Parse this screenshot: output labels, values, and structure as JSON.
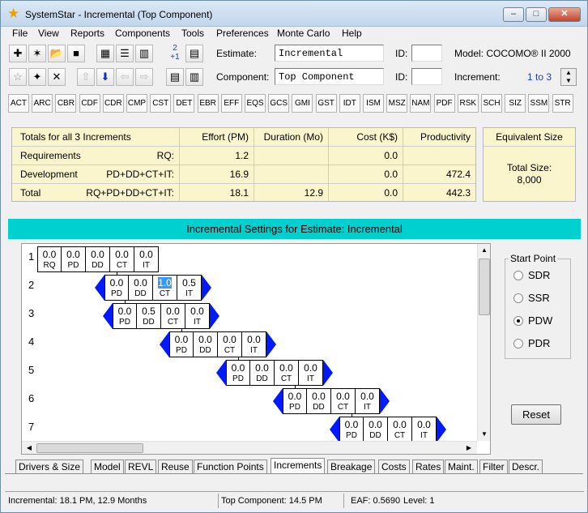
{
  "window": {
    "title": "SystemStar - Incremental (Top Component)",
    "icon": "star-icon"
  },
  "menu": [
    "File",
    "View",
    "Reports",
    "Components",
    "Tools",
    "Preferences",
    "Monte Carlo",
    "Help"
  ],
  "toolbar": {
    "row1_icons": [
      "new-estimate-icon",
      "new-star-icon",
      "open-folder-icon",
      "save-disk-icon",
      "grid-view-icon",
      "list-view-icon",
      "chart-view-icon",
      "increment-counter-icon",
      "report-icon"
    ],
    "row2_icons": [
      "star-outline-icon",
      "star-tree-icon",
      "delete-x-icon",
      "arrow-up-icon",
      "arrow-down-icon",
      "arrow-left-icon",
      "arrow-right-icon",
      "document-icon",
      "document-detail-icon"
    ],
    "increment_label_top": "2",
    "increment_label_bottom": "+1"
  },
  "estimate": {
    "label": "Estimate:",
    "value": "Incremental",
    "id_label": "ID:",
    "id_value": "",
    "model": "Model: COCOMO® II 2000"
  },
  "component": {
    "label": "Component:",
    "value": "Top Component",
    "id_label": "ID:",
    "id_value": "",
    "increment_label": "Increment:",
    "increment_range": "1 to 3"
  },
  "driver_tags": [
    "ACT",
    "ARC",
    "CBR",
    "CDF",
    "CDR",
    "CMP",
    "CST",
    "DET",
    "EBR",
    "EFF",
    "EQS",
    "GCS",
    "GMI",
    "GST",
    "IDT",
    "ISM",
    "MSZ",
    "NAM",
    "PDF",
    "RSK",
    "SCH",
    "SIZ",
    "SSM",
    "STR"
  ],
  "summary": {
    "headers": [
      "Totals for all 3 Increments",
      "Effort (PM)",
      "Duration (Mo)",
      "Cost (K$)",
      "Productivity"
    ],
    "rows": [
      {
        "name": "Requirements",
        "code": "RQ:",
        "effort": "1.2",
        "duration": "",
        "cost": "0.0",
        "productivity": ""
      },
      {
        "name": "Development",
        "code": "PD+DD+CT+IT:",
        "effort": "16.9",
        "duration": "",
        "cost": "0.0",
        "productivity": "472.4"
      },
      {
        "name": "Total",
        "code": "RQ+PD+DD+CT+IT:",
        "effort": "18.1",
        "duration": "12.9",
        "cost": "0.0",
        "productivity": "442.3"
      }
    ],
    "equivalent_size": {
      "header": "Equivalent Size",
      "label": "Total Size:",
      "value": "8,000"
    }
  },
  "incremental": {
    "banner": "Incremental Settings for Estimate: Incremental",
    "increments": [
      {
        "n": "1",
        "phases": [
          {
            "p": "RQ",
            "v": "0.0"
          },
          {
            "p": "PD",
            "v": "0.0"
          },
          {
            "p": "DD",
            "v": "0.0"
          },
          {
            "p": "CT",
            "v": "0.0"
          },
          {
            "p": "IT",
            "v": "0.0"
          }
        ],
        "arrows": false
      },
      {
        "n": "2",
        "phases": [
          {
            "p": "PD",
            "v": "0.0"
          },
          {
            "p": "DD",
            "v": "0.0"
          },
          {
            "p": "CT",
            "v": "1.0"
          },
          {
            "p": "IT",
            "v": "0.5"
          }
        ],
        "arrows": true
      },
      {
        "n": "3",
        "phases": [
          {
            "p": "PD",
            "v": "0.0"
          },
          {
            "p": "DD",
            "v": "0.5"
          },
          {
            "p": "CT",
            "v": "0.0"
          },
          {
            "p": "IT",
            "v": "0.0"
          }
        ],
        "arrows": true
      },
      {
        "n": "4",
        "phases": [
          {
            "p": "PD",
            "v": "0.0"
          },
          {
            "p": "DD",
            "v": "0.0"
          },
          {
            "p": "CT",
            "v": "0.0"
          },
          {
            "p": "IT",
            "v": "0.0"
          }
        ],
        "arrows": true
      },
      {
        "n": "5",
        "phases": [
          {
            "p": "PD",
            "v": "0.0"
          },
          {
            "p": "DD",
            "v": "0.0"
          },
          {
            "p": "CT",
            "v": "0.0"
          },
          {
            "p": "IT",
            "v": "0.0"
          }
        ],
        "arrows": true
      },
      {
        "n": "6",
        "phases": [
          {
            "p": "PD",
            "v": "0.0"
          },
          {
            "p": "DD",
            "v": "0.0"
          },
          {
            "p": "CT",
            "v": "0.0"
          },
          {
            "p": "IT",
            "v": "0.0"
          }
        ],
        "arrows": true
      },
      {
        "n": "7",
        "phases": [
          {
            "p": "PD",
            "v": "0.0"
          },
          {
            "p": "DD",
            "v": "0.0"
          },
          {
            "p": "CT",
            "v": "0.0"
          },
          {
            "p": "IT",
            "v": "0.0"
          }
        ],
        "arrows": true
      }
    ],
    "selected_value": "1.0"
  },
  "start_point": {
    "legend": "Start Point",
    "options": [
      "SDR",
      "SSR",
      "PDW",
      "PDR"
    ],
    "selected": "PDW"
  },
  "reset_label": "Reset",
  "tabs": [
    "Drivers & Size",
    "Model",
    "REVL",
    "Reuse",
    "Function Points",
    "Increments",
    "Breakage",
    "Costs",
    "Rates",
    "Maint.",
    "Filter",
    "Descr."
  ],
  "active_tab": "Increments",
  "status": {
    "left": "Incremental:  18.1 PM,  12.9 Months",
    "middle": "Top Component:  14.5 PM",
    "eaf": "EAF: 0.5690",
    "level": "Level:   1"
  },
  "colors": {
    "banner": "#00d0d0",
    "summary_bg": "#fbf5cd",
    "arrow_blue": "#0019ff",
    "selection": "#3399ff"
  }
}
